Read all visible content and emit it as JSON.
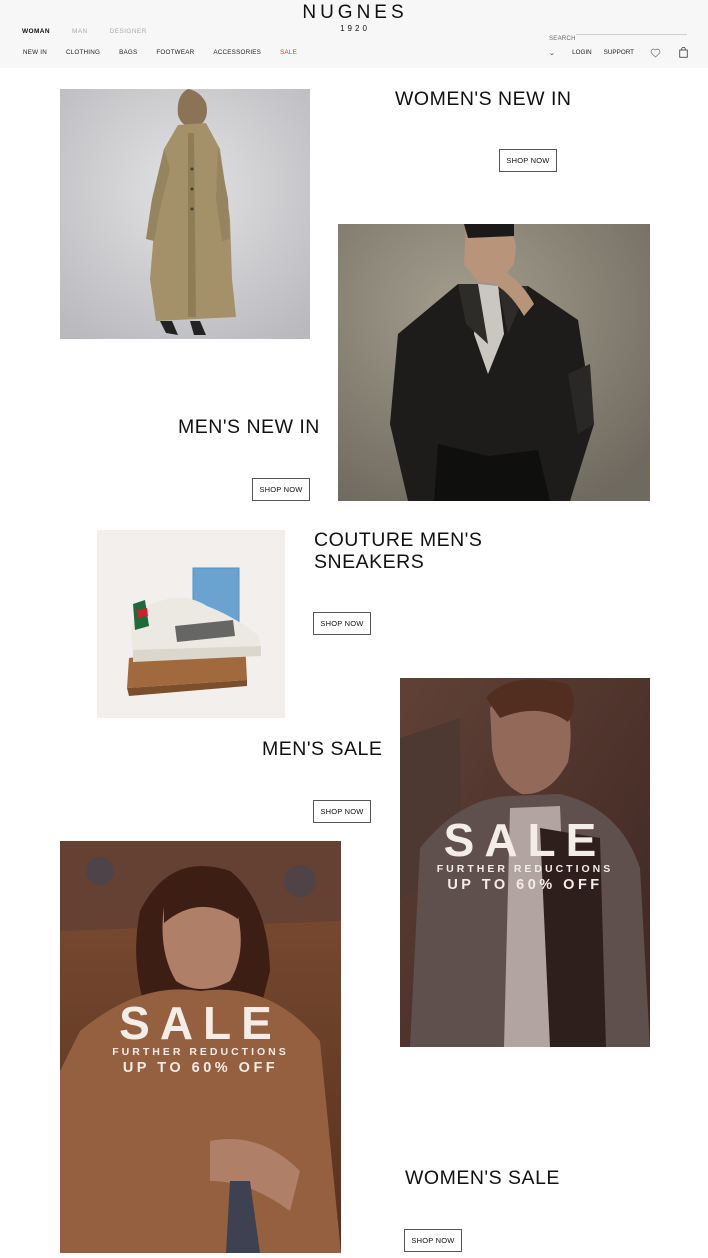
{
  "header": {
    "brand": "NUGNES",
    "brand_year": "1920",
    "gender_tabs": [
      "WOMAN",
      "MAN",
      "DESIGNER"
    ],
    "search_label": "SEARCH",
    "search_value": "",
    "nav": [
      "NEW IN",
      "CLOTHING",
      "BAGS",
      "FOOTWEAR",
      "ACCESSORIES",
      "SALE"
    ],
    "login": "LOGIN",
    "support": "SUPPORT",
    "sale_color": "#e6342c"
  },
  "blocks": {
    "womens_new_in": {
      "title": "WOMEN'S NEW IN",
      "cta": "SHOP NOW"
    },
    "mens_new_in": {
      "title": "MEN'S NEW IN",
      "cta": "SHOP NOW"
    },
    "couture_sneakers": {
      "title_line1": "COUTURE MEN'S",
      "title_line2": "SNEAKERS",
      "cta": "SHOP NOW"
    },
    "mens_sale": {
      "title": "MEN'S SALE",
      "cta": "SHOP NOW",
      "overlay_big": "SALE",
      "overlay_line1": "FURTHER REDUCTIONS",
      "overlay_line2": "UP TO 60% OFF"
    },
    "womens_sale": {
      "title": "WOMEN'S SALE",
      "cta": "SHOP NOW",
      "overlay_big": "SALE",
      "overlay_line1": "FURTHER REDUCTIONS",
      "overlay_line2": "UP TO 60% OFF"
    }
  },
  "icons": {
    "dropdown": "chevron-down-icon",
    "wishlist": "heart-icon",
    "cart": "shopping-bag-icon"
  }
}
